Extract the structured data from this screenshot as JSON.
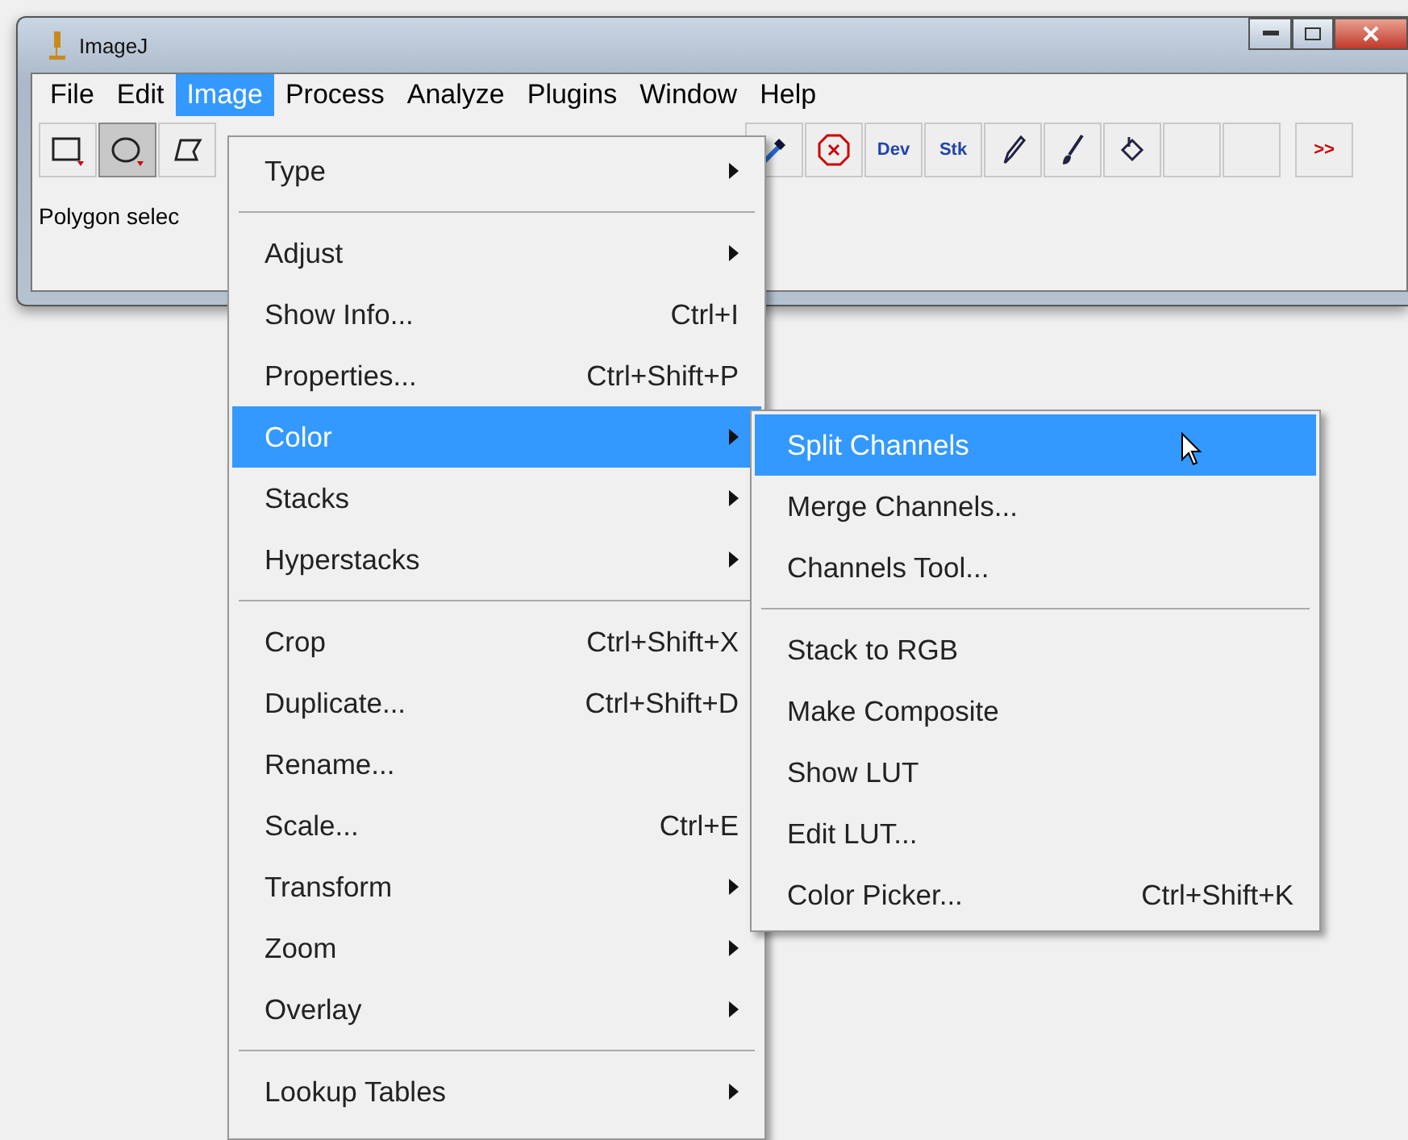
{
  "window": {
    "title": "ImageJ"
  },
  "menu_bar": [
    {
      "label": "File",
      "selected": false
    },
    {
      "label": "Edit",
      "selected": false
    },
    {
      "label": "Image",
      "selected": true
    },
    {
      "label": "Process",
      "selected": false
    },
    {
      "label": "Analyze",
      "selected": false
    },
    {
      "label": "Plugins",
      "selected": false
    },
    {
      "label": "Window",
      "selected": false
    },
    {
      "label": "Help",
      "selected": false
    }
  ],
  "toolbar_left": [
    {
      "kind": "rect",
      "selected": false
    },
    {
      "kind": "oval",
      "selected": true
    },
    {
      "kind": "polygon",
      "selected": false
    }
  ],
  "toolbar_right": [
    {
      "kind": "dropper"
    },
    {
      "kind": "stop"
    },
    {
      "kind": "text",
      "label": "Dev"
    },
    {
      "kind": "text",
      "label": "Stk"
    },
    {
      "kind": "pencil"
    },
    {
      "kind": "brush"
    },
    {
      "kind": "bucket"
    },
    {
      "kind": "empty"
    },
    {
      "kind": "empty"
    },
    {
      "kind": "more",
      "label": ">>"
    }
  ],
  "status": "Polygon selec",
  "image_menu": [
    {
      "kind": "item",
      "label": "Type",
      "submenu": true,
      "selected": false
    },
    {
      "kind": "separator"
    },
    {
      "kind": "item",
      "label": "Adjust",
      "submenu": true,
      "selected": false
    },
    {
      "kind": "item",
      "label": "Show Info...",
      "shortcut": "Ctrl+I",
      "selected": false
    },
    {
      "kind": "item",
      "label": "Properties...",
      "shortcut": "Ctrl+Shift+P",
      "selected": false
    },
    {
      "kind": "item",
      "label": "Color",
      "submenu": true,
      "selected": true
    },
    {
      "kind": "item",
      "label": "Stacks",
      "submenu": true,
      "selected": false
    },
    {
      "kind": "item",
      "label": "Hyperstacks",
      "submenu": true,
      "selected": false
    },
    {
      "kind": "separator"
    },
    {
      "kind": "item",
      "label": "Crop",
      "shortcut": "Ctrl+Shift+X",
      "selected": false
    },
    {
      "kind": "item",
      "label": "Duplicate...",
      "shortcut": "Ctrl+Shift+D",
      "selected": false
    },
    {
      "kind": "item",
      "label": "Rename...",
      "selected": false
    },
    {
      "kind": "item",
      "label": "Scale...",
      "shortcut": "Ctrl+E",
      "selected": false
    },
    {
      "kind": "item",
      "label": "Transform",
      "submenu": true,
      "selected": false
    },
    {
      "kind": "item",
      "label": "Zoom",
      "submenu": true,
      "selected": false
    },
    {
      "kind": "item",
      "label": "Overlay",
      "submenu": true,
      "selected": false
    },
    {
      "kind": "separator"
    },
    {
      "kind": "item",
      "label": "Lookup Tables",
      "submenu": true,
      "selected": false
    }
  ],
  "color_menu": [
    {
      "kind": "item",
      "label": "Split Channels",
      "selected": true
    },
    {
      "kind": "item",
      "label": "Merge Channels...",
      "selected": false
    },
    {
      "kind": "item",
      "label": "Channels Tool...",
      "selected": false
    },
    {
      "kind": "separator"
    },
    {
      "kind": "item",
      "label": "Stack to RGB",
      "selected": false
    },
    {
      "kind": "item",
      "label": "Make Composite",
      "selected": false
    },
    {
      "kind": "item",
      "label": "Show LUT",
      "selected": false
    },
    {
      "kind": "item",
      "label": "Edit LUT...",
      "selected": false
    },
    {
      "kind": "item",
      "label": "Color Picker...",
      "shortcut": "Ctrl+Shift+K",
      "selected": false
    }
  ]
}
